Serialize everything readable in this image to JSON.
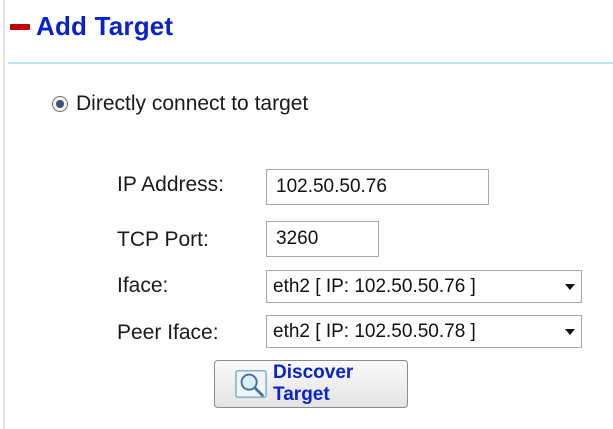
{
  "section": {
    "title": "Add Target"
  },
  "connect_mode": {
    "label": "Directly connect to target",
    "selected": true
  },
  "form": {
    "ip_address": {
      "label": "IP Address:",
      "value": "102.50.50.76"
    },
    "tcp_port": {
      "label": "TCP Port:",
      "value": "3260"
    },
    "iface": {
      "label": "Iface:",
      "value": "eth2 [ IP: 102.50.50.76 ]"
    },
    "peer_iface": {
      "label": "Peer Iface:",
      "value": "eth2 [ IP: 102.50.50.78 ]"
    }
  },
  "discover_button": {
    "label": "Discover Target",
    "icon": "magnifier-icon"
  },
  "colors": {
    "title": "#0a22cc",
    "collapse": "#c00000",
    "rule": "#bde3ee"
  }
}
